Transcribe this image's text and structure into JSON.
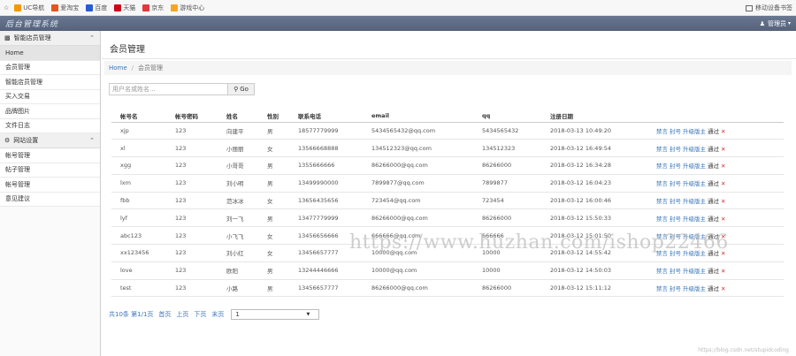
{
  "bookmarks": [
    {
      "label": "UC导航",
      "color": "#f39800"
    },
    {
      "label": "爱淘宝",
      "color": "#e8541d"
    },
    {
      "label": "百度",
      "color": "#2a5bd7"
    },
    {
      "label": "天猫",
      "color": "#d0021b"
    },
    {
      "label": "京东",
      "color": "#e4393c"
    },
    {
      "label": "游戏中心",
      "color": "#f5a623"
    }
  ],
  "bookmarks_right": "移动设备书签",
  "app": {
    "title": "后台管理系统",
    "user": "管理员"
  },
  "sidebar": {
    "sections": [
      {
        "title": "智能店员管理",
        "items": [
          "Home",
          "会员管理",
          "智能店员管理",
          "买入交易",
          "品牌图片",
          "文件日志"
        ]
      },
      {
        "title": "网站设置",
        "items": [
          "帐号管理",
          "帖子管理",
          "帐号管理",
          "意见建议"
        ]
      }
    ]
  },
  "main": {
    "title": "会员管理",
    "breadcrumb": {
      "home": "Home",
      "current": "会员管理"
    },
    "search": {
      "placeholder": "用户名或姓名...",
      "button": "Go"
    },
    "table": {
      "headers": [
        "帐号名",
        "帐号密码",
        "姓名",
        "性别",
        "联系电话",
        "email",
        "qq",
        "注册日期",
        ""
      ],
      "actions": {
        "a": "禁言",
        "b": "封号",
        "c": "升级版主",
        "d": "通过",
        "x": "✕"
      },
      "rows": [
        [
          "xjp",
          "123",
          "向建平",
          "男",
          "18577779999",
          "5434565432@qq.com",
          "5434565432",
          "2018-03-13 10:49:20"
        ],
        [
          "xl",
          "123",
          "小丽丽",
          "女",
          "13566668888",
          "134512323@qq.com",
          "134512323",
          "2018-03-12 16:49:54"
        ],
        [
          "xgg",
          "123",
          "小哥哥",
          "男",
          "1355666666",
          "86266000@qq.com",
          "86266000",
          "2018-03-12 16:34:28"
        ],
        [
          "lxm",
          "123",
          "刘小明",
          "男",
          "13499990000",
          "7899877@qq.com",
          "7899877",
          "2018-03-12 16:04:23"
        ],
        [
          "fbb",
          "123",
          "范冰冰",
          "女",
          "13656435656",
          "723454@qq.com",
          "723454",
          "2018-03-12 16:00:46"
        ],
        [
          "lyf",
          "123",
          "刘一飞",
          "男",
          "13477779999",
          "86266000@qq.com",
          "86266000",
          "2018-03-12 15:50:33"
        ],
        [
          "abc123",
          "123",
          "小飞飞",
          "女",
          "13456656666",
          "666666@qq.com",
          "666666",
          "2018-03-12 15:01:50"
        ],
        [
          "xx123456",
          "123",
          "刘小红",
          "女",
          "13456657777",
          "10000@qq.com",
          "10000",
          "2018-03-12 14:55:42"
        ],
        [
          "love",
          "123",
          "欧阳",
          "男",
          "13244446666",
          "10000@qq.com",
          "10000",
          "2018-03-12 14:50:03"
        ],
        [
          "test",
          "123",
          "小路",
          "男",
          "13456657777",
          "86266000@qq.com",
          "86266000",
          "2018-03-12 15:11:12"
        ]
      ]
    },
    "pager": {
      "summary": "共10条 第1/1页",
      "first": "首页",
      "prev": "上页",
      "next": "下页",
      "last": "末页",
      "page_value": "1"
    }
  },
  "watermark": "https://www.huzhan.com/ishop22466",
  "watermark_small": "https://blog.csdn.net/stupidcoding"
}
